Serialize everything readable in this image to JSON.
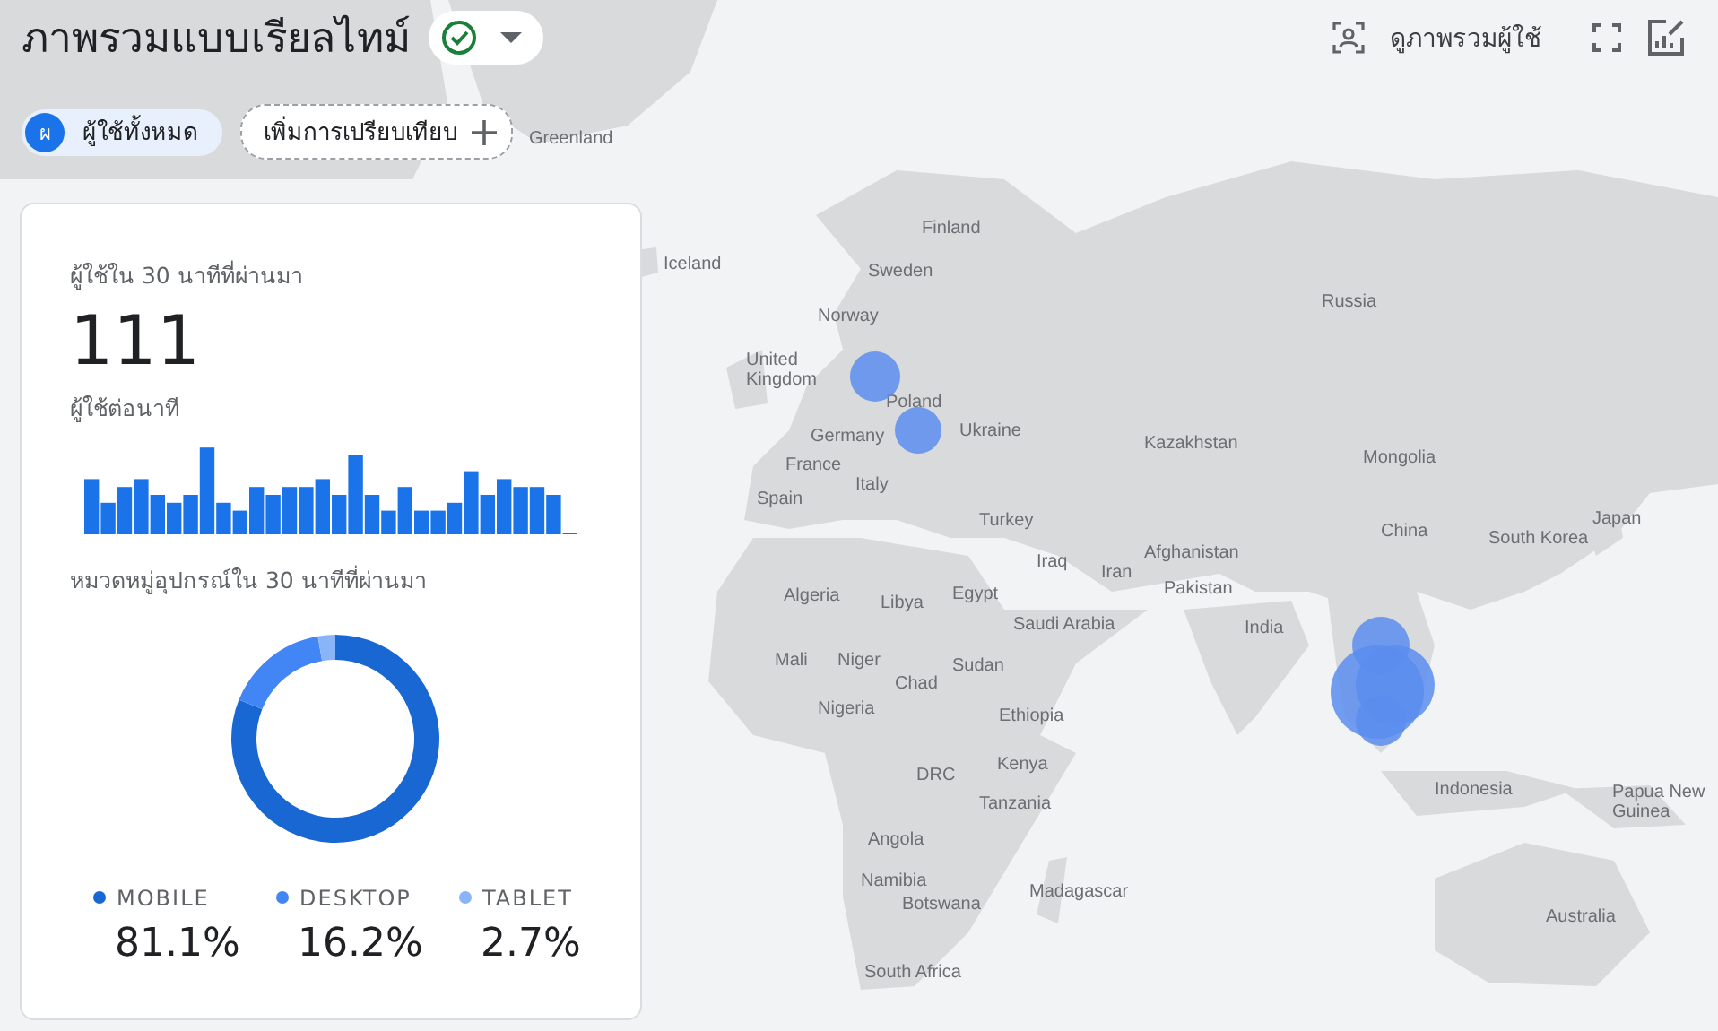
{
  "header": {
    "title": "ภาพรวมแบบเรียลไทม์",
    "user_overview_link": "ดูภาพรวมผู้ใช้"
  },
  "comparisons": {
    "avatar_letter": "ผ",
    "selected_segment": "ผู้ใช้ทั้งหมด",
    "add_comparison": "เพิ่มการเปรียบเทียบ"
  },
  "card": {
    "users_label": "ผู้ใช้ใน 30 นาทีที่ผ่านมา",
    "users_value": "111",
    "per_minute_label": "ผู้ใช้ต่อนาที",
    "devices_label": "หมวดหมู่อุปกรณ์ใน 30 นาทีที่ผ่านมา",
    "chart_data": {
      "type": "donut",
      "categories": [
        "MOBILE",
        "DESKTOP",
        "TABLET"
      ],
      "values": [
        81.1,
        16.2,
        2.7
      ]
    },
    "legend": [
      {
        "percent": "81.1%",
        "color": "#1967d2"
      },
      {
        "percent": "16.2%",
        "color": "#4285f4"
      },
      {
        "percent": "2.7%",
        "color": "#8ab4f8"
      }
    ]
  },
  "map_labels": [
    "Greenland",
    "Iceland",
    "Finland",
    "Sweden",
    "Norway",
    "United\nKingdom",
    "Poland",
    "Germany",
    "Ukraine",
    "France",
    "Italy",
    "Spain",
    "Turkey",
    "Russia",
    "Kazakhstan",
    "Mongolia",
    "China",
    "South Korea",
    "Japan",
    "Afghanistan",
    "Pakistan",
    "Iraq",
    "Iran",
    "Algeria",
    "Libya",
    "Egypt",
    "Saudi Arabia",
    "India",
    "Mali",
    "Niger",
    "Chad",
    "Sudan",
    "Nigeria",
    "Ethiopia",
    "DRC",
    "Kenya",
    "Tanzania",
    "Angola",
    "Namibia",
    "Botswana",
    "Madagascar",
    "South Africa",
    "Indonesia",
    "Papua New\nGuinea",
    "Australia"
  ]
}
